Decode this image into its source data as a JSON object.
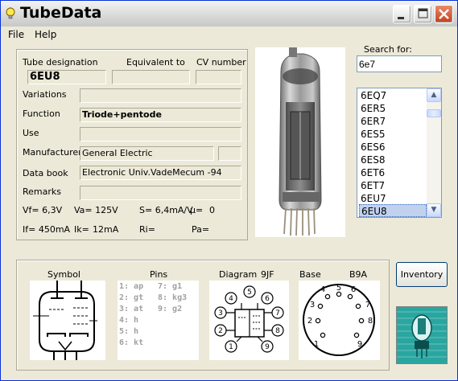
{
  "window": {
    "title": "TubeData",
    "icon": "lightbulb-icon"
  },
  "menu": {
    "file": "File",
    "help": "Help"
  },
  "tube": {
    "designation_label": "Tube designation",
    "equivalent_label": "Equivalent to",
    "cv_label": "CV number",
    "designation": "6EU8",
    "equivalent": "",
    "cv": "",
    "variations_label": "Variations",
    "variations": "",
    "function_label": "Function",
    "function": "Triode+pentode",
    "use_label": "Use",
    "use": "",
    "manufacturer_label": "Manufacturer",
    "manufacturer": "General Electric",
    "manufacturer_code": "",
    "databook_label": "Data book",
    "databook": "Electronic Univ.VadeMecum -94",
    "remarks_label": "Remarks",
    "remarks": ""
  },
  "params": {
    "vf": "Vf= 6,3V",
    "va": "Va= 125V",
    "s": "S= 6,4mA/V",
    "mu": "µ=",
    "mu_val": "0",
    "if": "If= 450mA",
    "ik": "Ik=",
    "ik_val": "12mA",
    "ri": "Ri=",
    "pa": "Pa="
  },
  "search": {
    "label": "Search for:",
    "value": "6e7",
    "items": [
      "6EQ7",
      "6ER5",
      "6ER7",
      "6ES5",
      "6ES6",
      "6ES8",
      "6ET6",
      "6ET7",
      "6EU7",
      "6EU8"
    ],
    "selected_index": 9
  },
  "lower": {
    "symbol_label": "Symbol",
    "pins_label": "Pins",
    "diagram_label": "Diagram",
    "diagram_code": "9JF",
    "base_label": "Base",
    "base_code": "B9A",
    "pins_col1": [
      "1: ap",
      "2: gt",
      "3: at",
      "4: h",
      "5: h",
      "6: kt"
    ],
    "pins_col2": [
      "7: g1",
      "8: kg3",
      "9: g2"
    ],
    "base_numbers": [
      "4",
      "5",
      "6",
      "3",
      "7",
      "2",
      "8",
      "1",
      "9"
    ]
  },
  "buttons": {
    "inventory": "Inventory"
  },
  "colors": {
    "title_bar": "#e0e0e0",
    "close": "#c4401c",
    "selection": "#c1d2ee",
    "pins_text": "#a0a0a0"
  }
}
